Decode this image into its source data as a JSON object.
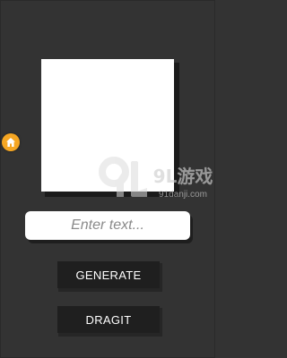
{
  "input": {
    "placeholder": "Enter text..."
  },
  "buttons": {
    "generate_label": "GENERATE",
    "dragit_label": "DRAGIT"
  },
  "side_button": {
    "icon": "home-icon",
    "color": "#f5a623"
  },
  "watermark": {
    "logo_text": "9L游戏",
    "site_text": "91danji.com"
  },
  "colors": {
    "background": "#333333",
    "button": "#1f1f1f",
    "accent": "#f5a623"
  }
}
